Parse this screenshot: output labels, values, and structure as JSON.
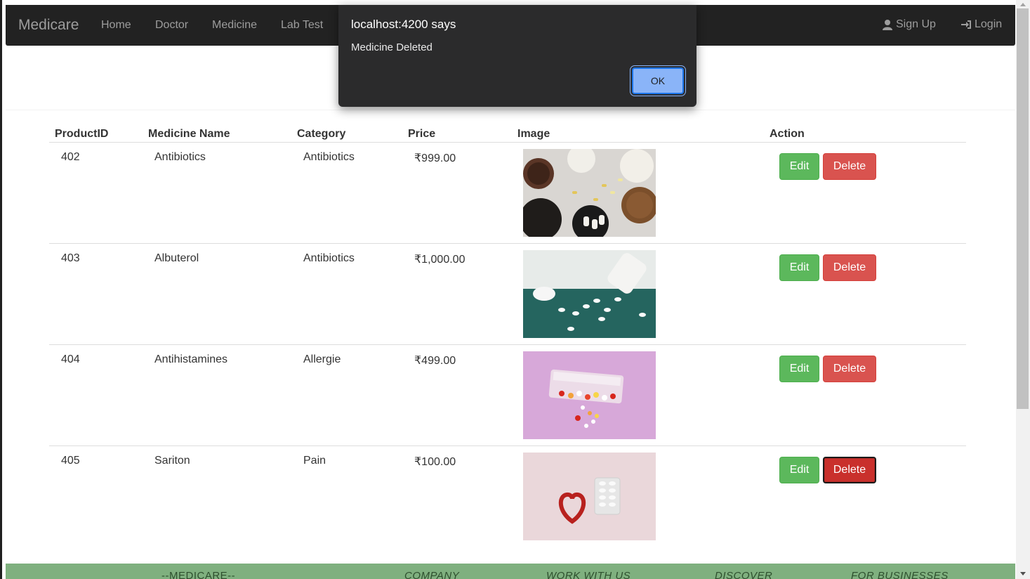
{
  "navbar": {
    "brand": "Medicare",
    "links": [
      "Home",
      "Doctor",
      "Medicine",
      "Lab Test"
    ],
    "signup_label": "Sign Up",
    "login_label": "Login"
  },
  "dialog": {
    "title": "localhost:4200 says",
    "message": "Medicine Deleted",
    "ok_label": "OK"
  },
  "table": {
    "headers": [
      "ProductID",
      "Medicine Name",
      "Category",
      "Price",
      "Image",
      "Action"
    ],
    "rows": [
      {
        "id": "402",
        "name": "Antibiotics",
        "category": "Antibiotics",
        "price": "₹999.00"
      },
      {
        "id": "403",
        "name": "Albuterol",
        "category": "Antibiotics",
        "price": "₹1,000.00"
      },
      {
        "id": "404",
        "name": "Antihistamines",
        "category": "Allergie",
        "price": "₹499.00"
      },
      {
        "id": "405",
        "name": "Sariton",
        "category": "Pain",
        "price": "₹100.00"
      }
    ],
    "edit_label": "Edit",
    "delete_label": "Delete"
  },
  "footer": {
    "items": [
      "--MEDICARE--",
      "COMPANY",
      "WORK WITH US",
      "DISCOVER",
      "FOR BUSINESSES"
    ]
  },
  "colors": {
    "navbar": "#222222",
    "edit": "#5cb85c",
    "delete": "#d9534f",
    "footer": "#7fb07f"
  }
}
